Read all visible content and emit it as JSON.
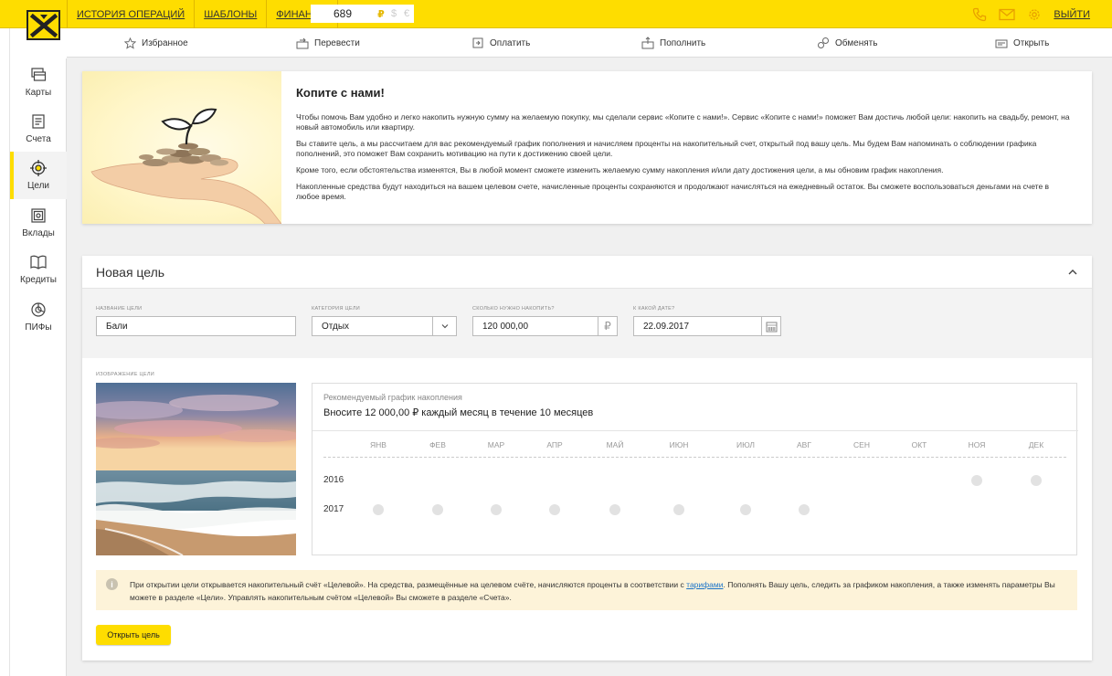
{
  "topbar": {
    "links": [
      "ИСТОРИЯ ОПЕРАЦИЙ",
      "ШАБЛОНЫ",
      "ФИНАНСЫ"
    ],
    "balance": "689",
    "currencies": [
      "₽",
      "$",
      "€"
    ],
    "logout": "ВЫЙТИ"
  },
  "nav": {
    "items": [
      "Избранное",
      "Перевести",
      "Оплатить",
      "Пополнить",
      "Обменять",
      "Открыть"
    ]
  },
  "sidebar": {
    "items": [
      "Карты",
      "Счета",
      "Цели",
      "Вклады",
      "Кредиты",
      "ПИФы"
    ],
    "active": "Цели"
  },
  "promo": {
    "title": "Копите с нами!",
    "p1": "Чтобы помочь Вам удобно и легко накопить нужную сумму на желаемую покупку, мы сделали сервис «Копите с нами!». Сервис «Копите с нами!» поможет Вам достичь любой цели: накопить на свадьбу, ремонт, на новый автомобиль или квартиру.",
    "p2": "Вы ставите цель, а мы рассчитаем для вас рекомендуемый график пополнения и начисляем проценты на накопительный счет, открытый под вашу цель. Мы будем Вам напоминать о соблюдении графика пополнений, это поможет Вам сохранить мотивацию на пути к достижению своей цели.",
    "p3": "Кроме того, если обстоятельства изменятся, Вы в любой момент сможете изменить желаемую сумму накопления и/или дату достижения цели, а мы обновим график накопления.",
    "p4": "Накопленные средства будут находиться на вашем целевом счете, начисленные проценты сохраняются и продолжают начисляться на ежедневный остаток. Вы сможете воспользоваться деньгами на счете в любое время."
  },
  "goal": {
    "title": "Новая цель",
    "name_label": "НАЗВАНИЕ ЦЕЛИ",
    "name_value": "Бали",
    "category_label": "КАТЕГОРИЯ ЦЕЛИ",
    "category_value": "Отдых",
    "amount_label": "СКОЛЬКО НУЖНО НАКОПИТЬ?",
    "amount_value": "120 000,00",
    "amount_currency": "₽",
    "date_label": "К КАКОЙ ДАТЕ?",
    "date_value": "22.09.2017",
    "image_label": "ИЗОБРАЖЕНИЕ ЦЕЛИ"
  },
  "schedule": {
    "label": "Рекомендуемый график накопления",
    "title": "Вносите 12 000,00 ₽ каждый месяц в течение 10 месяцев",
    "months": [
      "ЯНВ",
      "ФЕВ",
      "МАР",
      "АПР",
      "МАЙ",
      "ИЮН",
      "ИЮЛ",
      "АВГ",
      "СЕН",
      "ОКТ",
      "НОЯ",
      "ДЕК"
    ],
    "rows": [
      {
        "year": "2016",
        "months": [
          "НОЯ",
          "ДЕК"
        ]
      },
      {
        "year": "2017",
        "months": [
          "ЯНВ",
          "ФЕВ",
          "МАР",
          "АПР",
          "МАЙ",
          "ИЮН",
          "ИЮЛ",
          "АВГ"
        ]
      }
    ]
  },
  "note": {
    "before": "При открытии цели открывается накопительный счёт «Целевой». На средства, размещённые на целевом счёте, начисляются проценты в соответствии с ",
    "link": "тарифами",
    "after": ". Пополнять Вашу цель, следить за графиком накопления, а также изменять параметры Вы можете в разделе «Цели». Управлять накопительным счётом «Целевой» Вы сможете в разделе «Счета»."
  },
  "open_button": "Открыть цель",
  "colors": {
    "brand": "#fedd00",
    "note_bg": "#fdf3d9",
    "link": "#1a73c8"
  }
}
